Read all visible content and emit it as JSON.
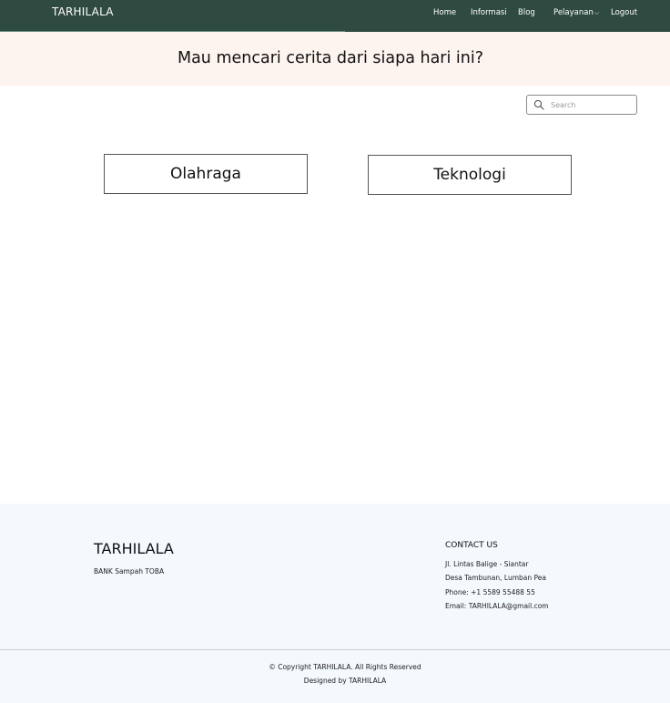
{
  "navbar": {
    "brand": "TARHILALA",
    "links": [
      {
        "label": "Home"
      },
      {
        "label": "Informasi"
      },
      {
        "label": "Blog"
      },
      {
        "label": "Pelayanan",
        "has_dropdown": true,
        "caret": "⌵"
      },
      {
        "label": "Logout"
      }
    ]
  },
  "hero": {
    "title": "Mau mencari cerita dari siapa hari ini?"
  },
  "search": {
    "placeholder": "Search",
    "icon": "search-icon"
  },
  "categories": [
    {
      "label": "Olahraga"
    },
    {
      "label": "Teknologi"
    }
  ],
  "footer": {
    "brand": "TARHILALA",
    "tagline": "BANK Sampah TOBA",
    "contact": {
      "title": "CONTACT US",
      "address_line1": "Jl. Lintas Balige - Siantar",
      "address_line2": "Desa Tambunan, Lumban Pea",
      "phone": "Phone: +1 5589 55488 55",
      "email": "Email: TARHILALA@gmail.com"
    },
    "copyright": "© Copyright TARHILALA. All Rights Reserved",
    "designed_by": "Designed by TARHILALA"
  },
  "colors": {
    "navbar": "#2f4a41",
    "hero_bg": "#fdf3ef",
    "footer_bg": "#f4f9fd"
  }
}
